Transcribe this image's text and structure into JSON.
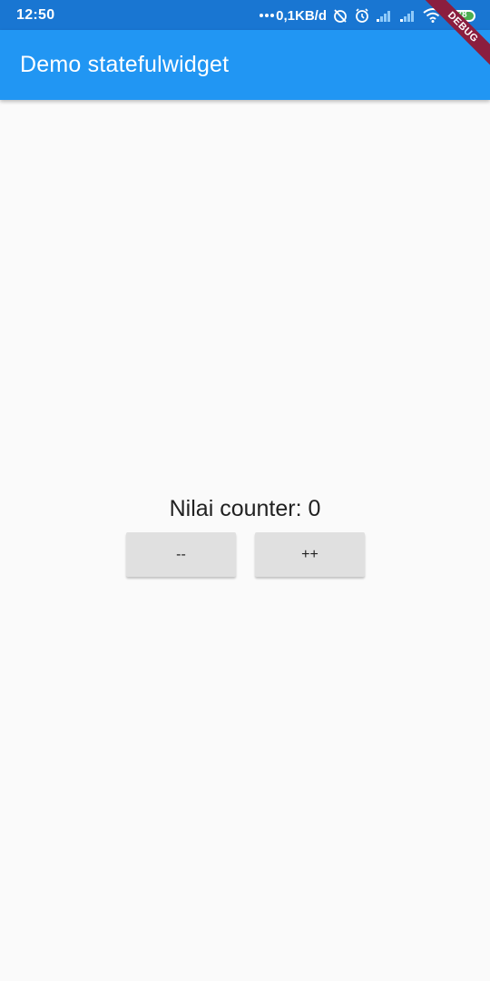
{
  "status_bar": {
    "time": "12:50",
    "net_speed": "0,1KB/d",
    "battery_level": "78",
    "icons": [
      "alarm-off-icon",
      "alarm-icon",
      "signal-icon",
      "signal-icon",
      "wifi-icon",
      "battery-icon"
    ]
  },
  "app_bar": {
    "title": "Demo statefulwidget",
    "color": "#2196f3"
  },
  "debug_banner": {
    "label": "DEBUG"
  },
  "counter": {
    "label": "Nilai counter: 0"
  },
  "buttons": {
    "decrement_label": "--",
    "increment_label": "++"
  }
}
